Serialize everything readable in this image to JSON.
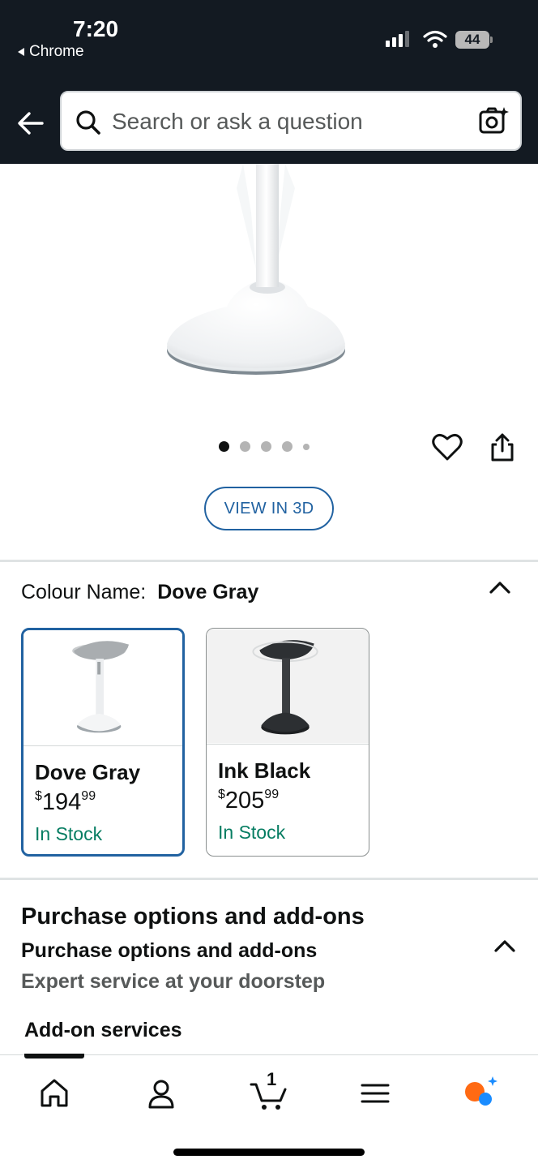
{
  "status": {
    "time": "7:20",
    "back_app": "Chrome",
    "battery": "44"
  },
  "header": {
    "search_placeholder": "Search or ask a question"
  },
  "gallery": {
    "dot_count": 5,
    "active_dot": 0,
    "view_3d_label": "VIEW IN 3D"
  },
  "colour": {
    "label": "Colour Name:",
    "selected": "Dove Gray",
    "options": [
      {
        "name": "Dove Gray",
        "price_currency": "$",
        "price_whole": "194",
        "price_fraction": "99",
        "stock": "In Stock",
        "selected": true
      },
      {
        "name": "Ink Black",
        "price_currency": "$",
        "price_whole": "205",
        "price_fraction": "99",
        "stock": "In Stock",
        "selected": false
      }
    ]
  },
  "purchase": {
    "title": "Purchase options and add-ons",
    "subtitle": "Purchase options and add-ons",
    "tagline": "Expert service at your doorstep",
    "addon_label": "Add-on services"
  },
  "bottom_nav": {
    "items": [
      "home-icon",
      "account-icon",
      "cart-icon",
      "menu-icon",
      "rufus-icon"
    ],
    "cart_count": "1"
  },
  "colors": {
    "header_bg": "#131a22",
    "accent_blue": "#2162a1",
    "in_stock_green": "#067d62",
    "rufus_orange": "#ff6a13",
    "rufus_blue": "#1a8cff"
  }
}
